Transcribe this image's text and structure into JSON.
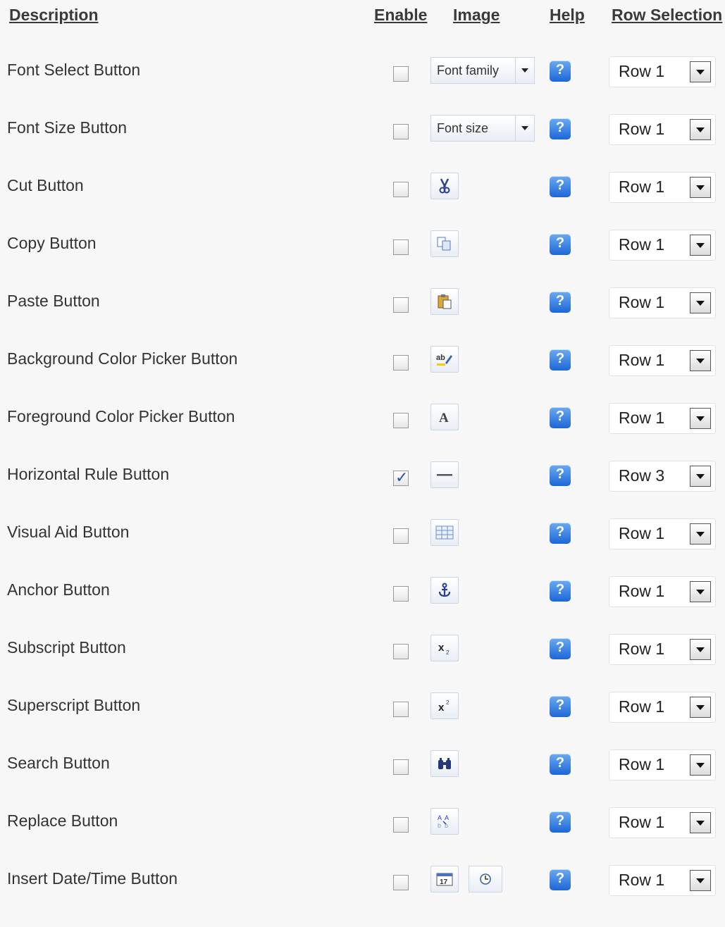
{
  "headers": {
    "description": "Description",
    "enable": "Enable",
    "image": "Image",
    "help": "Help",
    "row_selection": "Row Selection"
  },
  "rows": [
    {
      "description": "Font Select Button",
      "enabled": false,
      "image": {
        "type": "dropdown",
        "label": "Font family"
      },
      "row": "Row 1"
    },
    {
      "description": "Font Size Button",
      "enabled": false,
      "image": {
        "type": "dropdown",
        "label": "Font size"
      },
      "row": "Row 1"
    },
    {
      "description": "Cut Button",
      "enabled": false,
      "image": {
        "type": "icon",
        "icon": "scissors-icon"
      },
      "row": "Row 1"
    },
    {
      "description": "Copy Button",
      "enabled": false,
      "image": {
        "type": "icon",
        "icon": "copy-icon"
      },
      "row": "Row 1"
    },
    {
      "description": "Paste Button",
      "enabled": false,
      "image": {
        "type": "icon",
        "icon": "paste-icon"
      },
      "row": "Row 1"
    },
    {
      "description": "Background Color Picker Button",
      "enabled": false,
      "image": {
        "type": "icon",
        "icon": "highlight-color-icon"
      },
      "row": "Row 1"
    },
    {
      "description": "Foreground Color Picker Button",
      "enabled": false,
      "image": {
        "type": "icon",
        "icon": "font-color-icon"
      },
      "row": "Row 1"
    },
    {
      "description": "Horizontal Rule Button",
      "enabled": true,
      "image": {
        "type": "icon",
        "icon": "horizontal-rule-icon"
      },
      "row": "Row 3"
    },
    {
      "description": "Visual Aid Button",
      "enabled": false,
      "image": {
        "type": "icon",
        "icon": "visual-aid-grid-icon"
      },
      "row": "Row 1"
    },
    {
      "description": "Anchor Button",
      "enabled": false,
      "image": {
        "type": "icon",
        "icon": "anchor-icon"
      },
      "row": "Row 1"
    },
    {
      "description": "Subscript Button",
      "enabled": false,
      "image": {
        "type": "icon",
        "icon": "subscript-icon"
      },
      "row": "Row 1"
    },
    {
      "description": "Superscript Button",
      "enabled": false,
      "image": {
        "type": "icon",
        "icon": "superscript-icon"
      },
      "row": "Row 1"
    },
    {
      "description": "Search Button",
      "enabled": false,
      "image": {
        "type": "icon",
        "icon": "binoculars-icon"
      },
      "row": "Row 1"
    },
    {
      "description": "Replace Button",
      "enabled": false,
      "image": {
        "type": "icon",
        "icon": "replace-icon"
      },
      "row": "Row 1"
    },
    {
      "description": "Insert Date/Time Button",
      "enabled": false,
      "image": {
        "type": "icons",
        "icons": [
          "calendar-icon",
          "clock-icon"
        ]
      },
      "row": "Row 1"
    }
  ],
  "colors": {
    "help_blue": "#1d66d6",
    "check_blue": "#2d4fb0"
  }
}
